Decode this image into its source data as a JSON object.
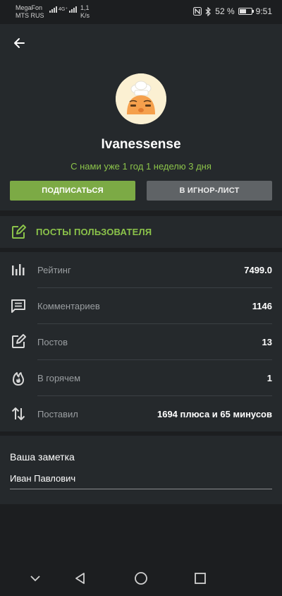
{
  "status_bar": {
    "carrier_1": "MegaFon",
    "carrier_2": "MTS RUS",
    "network": "4G⁺",
    "speed_value": "1,1",
    "speed_unit": "K/s",
    "battery": "52 %",
    "time": "9:51"
  },
  "profile": {
    "username": "Ivanessense",
    "member_since": "С нами уже 1 год 1 неделю 3 дня",
    "subscribe_label": "ПОДПИСАТЬСЯ",
    "ignore_label": "В ИГНОР-ЛИСТ",
    "accent_color": "#8bc34a"
  },
  "posts_link": {
    "label": "ПОСТЫ ПОЛЬЗОВАТЕЛЯ",
    "icon": "edit-icon"
  },
  "stats": [
    {
      "icon": "bar-chart-icon",
      "label": "Рейтинг",
      "value": "7499.0"
    },
    {
      "icon": "comment-icon",
      "label": "Комментариев",
      "value": "1146"
    },
    {
      "icon": "edit-icon",
      "label": "Постов",
      "value": "13"
    },
    {
      "icon": "fire-icon",
      "label": "В горячем",
      "value": "1"
    },
    {
      "icon": "swap-vertical-icon",
      "label": "Поставил",
      "value": "1694 плюса и 65 минусов"
    }
  ],
  "note": {
    "title": "Ваша заметка",
    "value": "Иван Павлович"
  }
}
